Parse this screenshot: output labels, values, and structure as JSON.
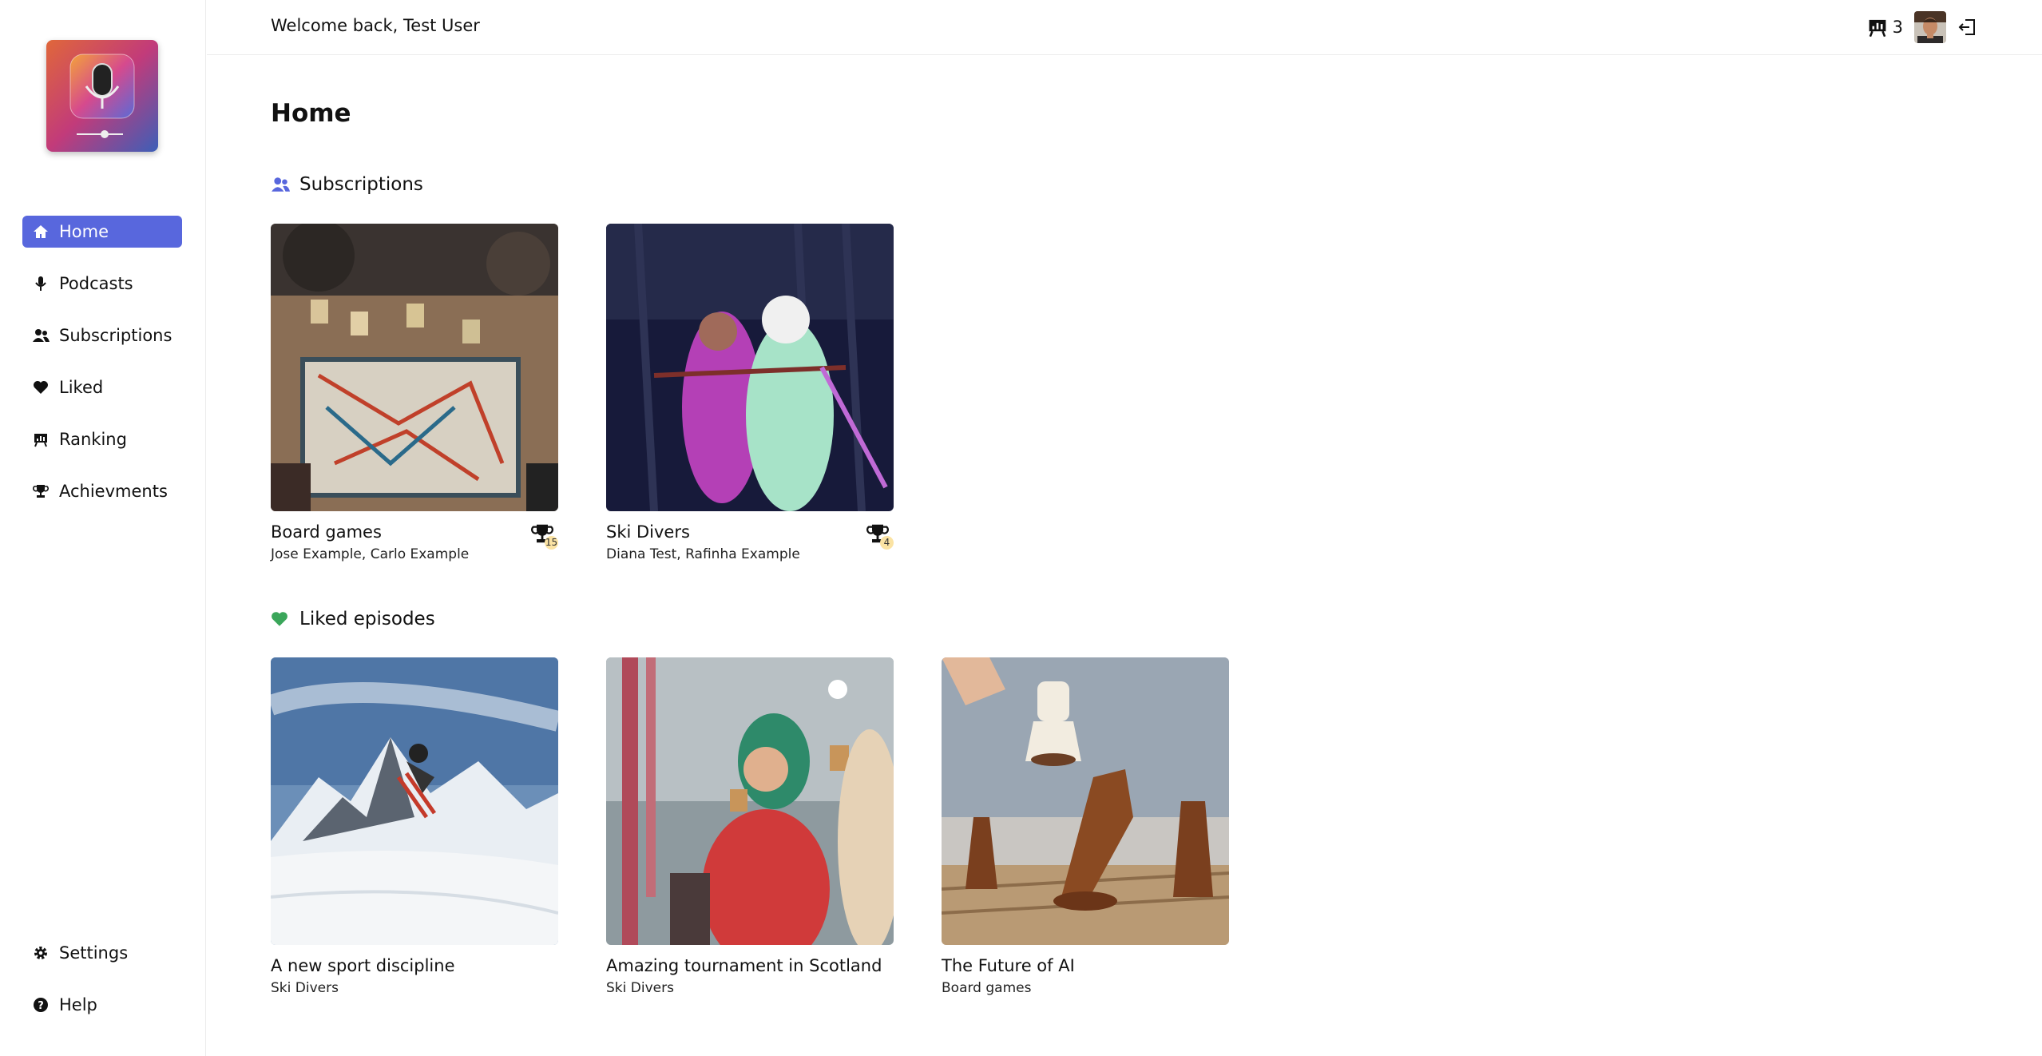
{
  "topbar": {
    "welcome_prefix": "Welcome back,",
    "user_name": "Test User",
    "rank_count": "3"
  },
  "sidebar": {
    "items": [
      {
        "label": "Home",
        "icon": "home-icon",
        "active": true
      },
      {
        "label": "Podcasts",
        "icon": "microphone-icon"
      },
      {
        "label": "Subscriptions",
        "icon": "users-icon"
      },
      {
        "label": "Liked",
        "icon": "heart-icon"
      },
      {
        "label": "Ranking",
        "icon": "ranking-icon"
      },
      {
        "label": "Achievments",
        "icon": "trophy-icon"
      }
    ],
    "bottom": [
      {
        "label": "Settings",
        "icon": "gear-icon"
      },
      {
        "label": "Help",
        "icon": "help-icon"
      }
    ]
  },
  "main": {
    "title": "Home",
    "subscriptions": {
      "title": "Subscriptions",
      "cards": [
        {
          "title": "Board games",
          "subtitle": "Jose Example, Carlo Example",
          "trophies": "15"
        },
        {
          "title": "Ski Divers",
          "subtitle": "Diana Test, Rafinha Example",
          "trophies": "4"
        }
      ]
    },
    "liked": {
      "title": "Liked episodes",
      "cards": [
        {
          "title": "A new sport discipline",
          "subtitle": "Ski Divers"
        },
        {
          "title": "Amazing tournament in Scotland",
          "subtitle": "Ski Divers"
        },
        {
          "title": "The Future of AI",
          "subtitle": "Board games"
        }
      ]
    }
  },
  "colors": {
    "accent": "#5867dd",
    "liked_heart": "#3aa65a",
    "subs_icon": "#5867dd"
  }
}
